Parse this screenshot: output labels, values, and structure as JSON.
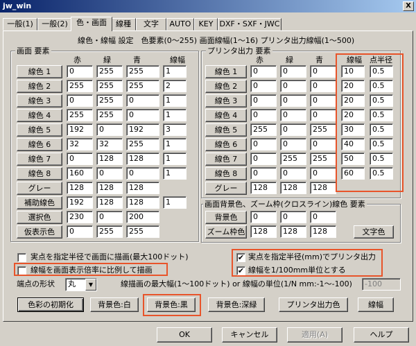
{
  "window": {
    "title": "jw_win",
    "close": "X"
  },
  "tabs": [
    "一般(1)",
    "一般(2)",
    "色・画面",
    "線種",
    "文字",
    "AUTO",
    "KEY",
    "DXF・SXF・JWC"
  ],
  "header": "線色・線幅 設定　色要素(0～255)  画面線幅(1～16)  プリンタ出力線幅(1～500)",
  "screen": {
    "title": "画面 要素",
    "cols": [
      "赤",
      "緑",
      "青",
      "線幅"
    ],
    "rows": [
      {
        "label": "線色 1",
        "r": "0",
        "g": "255",
        "b": "255",
        "w": "1"
      },
      {
        "label": "線色 2",
        "r": "255",
        "g": "255",
        "b": "255",
        "w": "2"
      },
      {
        "label": "線色 3",
        "r": "0",
        "g": "255",
        "b": "0",
        "w": "1"
      },
      {
        "label": "線色 4",
        "r": "255",
        "g": "255",
        "b": "0",
        "w": "1"
      },
      {
        "label": "線色 5",
        "r": "192",
        "g": "0",
        "b": "192",
        "w": "3"
      },
      {
        "label": "線色 6",
        "r": "32",
        "g": "32",
        "b": "255",
        "w": "1"
      },
      {
        "label": "線色 7",
        "r": "0",
        "g": "128",
        "b": "128",
        "w": "1"
      },
      {
        "label": "線色 8",
        "r": "160",
        "g": "0",
        "b": "0",
        "w": "1"
      },
      {
        "label": "グレー",
        "r": "128",
        "g": "128",
        "b": "128",
        "w": ""
      },
      {
        "label": "補助線色",
        "r": "192",
        "g": "128",
        "b": "128",
        "w": "1"
      },
      {
        "label": "選択色",
        "r": "230",
        "g": "0",
        "b": "200",
        "w": ""
      },
      {
        "label": "仮表示色",
        "r": "0",
        "g": "255",
        "b": "255",
        "w": ""
      }
    ]
  },
  "printer": {
    "title": "プリンタ出力 要素",
    "cols": [
      "赤",
      "緑",
      "青",
      "線幅",
      "点半径"
    ],
    "rows": [
      {
        "label": "線色 1",
        "r": "0",
        "g": "0",
        "b": "0",
        "w": "10",
        "p": "0.5"
      },
      {
        "label": "線色 2",
        "r": "0",
        "g": "0",
        "b": "0",
        "w": "20",
        "p": "0.5"
      },
      {
        "label": "線色 3",
        "r": "0",
        "g": "0",
        "b": "0",
        "w": "20",
        "p": "0.5"
      },
      {
        "label": "線色 4",
        "r": "0",
        "g": "0",
        "b": "0",
        "w": "20",
        "p": "0.5"
      },
      {
        "label": "線色 5",
        "r": "255",
        "g": "0",
        "b": "255",
        "w": "30",
        "p": "0.5"
      },
      {
        "label": "線色 6",
        "r": "0",
        "g": "0",
        "b": "0",
        "w": "40",
        "p": "0.5"
      },
      {
        "label": "線色 7",
        "r": "0",
        "g": "255",
        "b": "255",
        "w": "50",
        "p": "0.5"
      },
      {
        "label": "線色 8",
        "r": "0",
        "g": "0",
        "b": "0",
        "w": "60",
        "p": "0.5"
      },
      {
        "label": "グレー",
        "r": "128",
        "g": "128",
        "b": "128",
        "w": "",
        "p": ""
      }
    ]
  },
  "bg": {
    "title": "画面背景色、ズーム枠(クロスライン)線色 要素",
    "rows": [
      {
        "label": "背景色",
        "r": "0",
        "g": "0",
        "b": "0"
      },
      {
        "label": "ズーム枠色",
        "r": "128",
        "g": "128",
        "b": "128"
      }
    ],
    "text_color_button": "文字色"
  },
  "checks": [
    {
      "label": "実点を指定半径で画面に描画(最大100ドット)",
      "checked": false
    },
    {
      "label": "線幅を画面表示倍率に比例して描画",
      "checked": false
    },
    {
      "label": "実点を指定半径(mm)でプリンタ出力",
      "checked": true
    },
    {
      "label": "線幅を1/100mm単位とする",
      "checked": true
    }
  ],
  "endpoint": {
    "label": "端点の形状",
    "value": "丸",
    "width_label": "線描画の最大幅(1～100ドット) or 線幅の単位(1/N mm:-1～-100)",
    "width_value": "-100"
  },
  "buttons": {
    "init": "色彩の初期化",
    "bg_white": "背景色:白",
    "bg_black": "背景色:黒",
    "bg_navy": "背景色:深緑",
    "printer_color": "プリンタ出力色",
    "line_width": "線幅"
  },
  "footer": {
    "ok": "OK",
    "cancel": "キャンセル",
    "apply": "適用(A)",
    "help": "ヘルプ"
  },
  "colors": {
    "highlight": "#e8542a",
    "titlebar": "#0a246a",
    "face": "#d4d0c8"
  }
}
